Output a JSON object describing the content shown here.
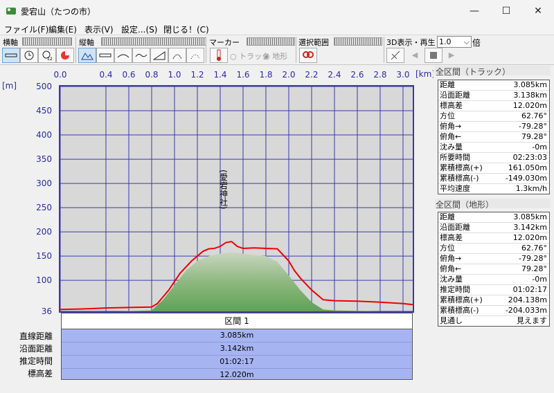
{
  "window": {
    "title": "愛宕山（たつの市）",
    "minimize": "—",
    "maximize": "☐",
    "close": "✕"
  },
  "menu": [
    "ファイル(F)",
    "編集(E)",
    "表示(V)",
    "設定...(S)",
    "閉じる！(C)"
  ],
  "toolbar": {
    "yokojiku": "横軸",
    "tatejiku": "縦軸",
    "marker": "マーカー",
    "track_label": "トラック",
    "terrain_label": "地形",
    "selection": "選択範囲",
    "view3d": "3D表示・再生",
    "speed_value": "1.0",
    "speed_unit": "倍"
  },
  "graph": {
    "x_unit": "[km]",
    "y_unit": "[m]",
    "x_ticks": [
      "0.0",
      "0.4",
      "0.6",
      "0.8",
      "1.0",
      "1.2",
      "1.4",
      "1.6",
      "1.8",
      "2.0",
      "2.2",
      "2.4",
      "2.6",
      "2.8",
      "3.0"
    ],
    "y_ticks": [
      "500",
      "450",
      "400",
      "350",
      "300",
      "250",
      "200",
      "150",
      "100",
      "36"
    ],
    "annotation": "(愛宕神社)"
  },
  "chart_data": {
    "type": "line",
    "title": "",
    "xlabel": "[km]",
    "ylabel": "[m]",
    "xlim": [
      0,
      3.085
    ],
    "ylim": [
      36,
      500
    ],
    "series": [
      {
        "x": [
          0.0,
          0.2,
          0.4,
          0.6,
          0.8,
          0.85,
          0.95,
          1.05,
          1.15,
          1.25,
          1.3,
          1.35,
          1.4,
          1.45,
          1.5,
          1.55,
          1.6,
          1.7,
          1.8,
          1.9,
          2.0,
          2.05,
          2.1,
          2.2,
          2.3,
          2.4,
          2.6,
          2.8,
          3.0,
          3.085
        ],
        "y": [
          40,
          41,
          43,
          44,
          45,
          52,
          80,
          115,
          140,
          160,
          165,
          166,
          170,
          178,
          180,
          170,
          166,
          167,
          166,
          165,
          140,
          120,
          105,
          80,
          60,
          58,
          57,
          55,
          52,
          50
        ]
      }
    ],
    "terrain_x": [
      0.0,
      0.5,
      0.8,
      0.9,
      1.0,
      1.1,
      1.2,
      1.3,
      1.4,
      1.5,
      1.6,
      1.7,
      1.8,
      1.9,
      2.0,
      2.1,
      2.2,
      2.3,
      2.4,
      2.6,
      2.8,
      3.085
    ],
    "terrain_y": [
      36,
      36,
      38,
      60,
      90,
      120,
      140,
      150,
      155,
      158,
      155,
      152,
      150,
      138,
      110,
      80,
      55,
      40,
      38,
      37,
      36,
      36
    ]
  },
  "right": {
    "track_title": "全区間（トラック）",
    "track_rows": [
      [
        "距離",
        "3.085km"
      ],
      [
        "沿面距離",
        "3.138km"
      ],
      [
        "標高差",
        "12.020m"
      ],
      [
        "方位",
        "62.76°"
      ],
      [
        "俯角→",
        "-79.28°"
      ],
      [
        "俯角←",
        "79.28°"
      ],
      [
        "沈み量",
        "-0m"
      ],
      [
        "所要時間",
        "02:23:03"
      ],
      [
        "累積標高(+)",
        "161.050m"
      ],
      [
        "累積標高(-)",
        "-149.030m"
      ],
      [
        "平均速度",
        "1.3km/h"
      ]
    ],
    "terrain_title": "全区間（地形）",
    "terrain_rows": [
      [
        "距離",
        "3.085km"
      ],
      [
        "沿面距離",
        "3.142km"
      ],
      [
        "標高差",
        "12.020m"
      ],
      [
        "方位",
        "62.76°"
      ],
      [
        "俯角→",
        "-79.28°"
      ],
      [
        "俯角←",
        "79.28°"
      ],
      [
        "沈み量",
        "-0m"
      ],
      [
        "推定時間",
        "01:02:17"
      ],
      [
        "累積標高(+)",
        "204.138m"
      ],
      [
        "累積標高(-)",
        "-204.033m"
      ],
      [
        "見通し",
        "見えます"
      ]
    ]
  },
  "segment": {
    "header": "区間 1",
    "labels": [
      "直線距離",
      "沿面距離",
      "推定時間",
      "標高差"
    ],
    "values": [
      "3.085km",
      "3.142km",
      "01:02:17",
      "12.020m"
    ]
  }
}
